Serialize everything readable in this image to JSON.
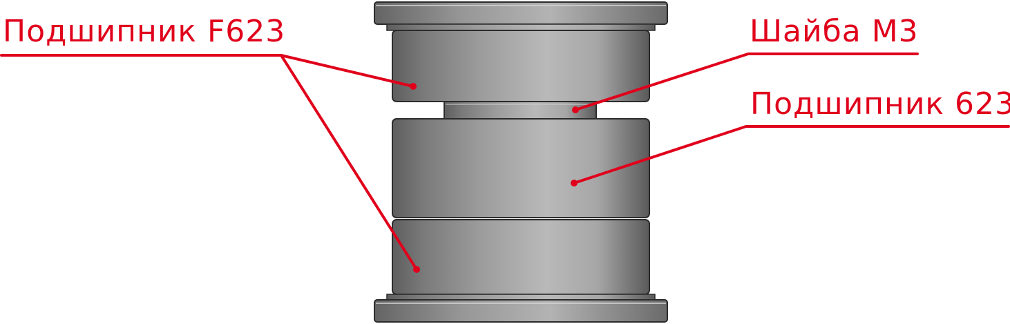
{
  "colors": {
    "accent": "#e0001b",
    "metal_dark": "#6b6b6b",
    "metal_light": "#b9b9b9",
    "edge": "#2b2b2b"
  },
  "labels": {
    "bearing_f623": "Подшипник F623",
    "washer_m3": "Шайба М3",
    "bearing_623": "Подшипник 623"
  }
}
